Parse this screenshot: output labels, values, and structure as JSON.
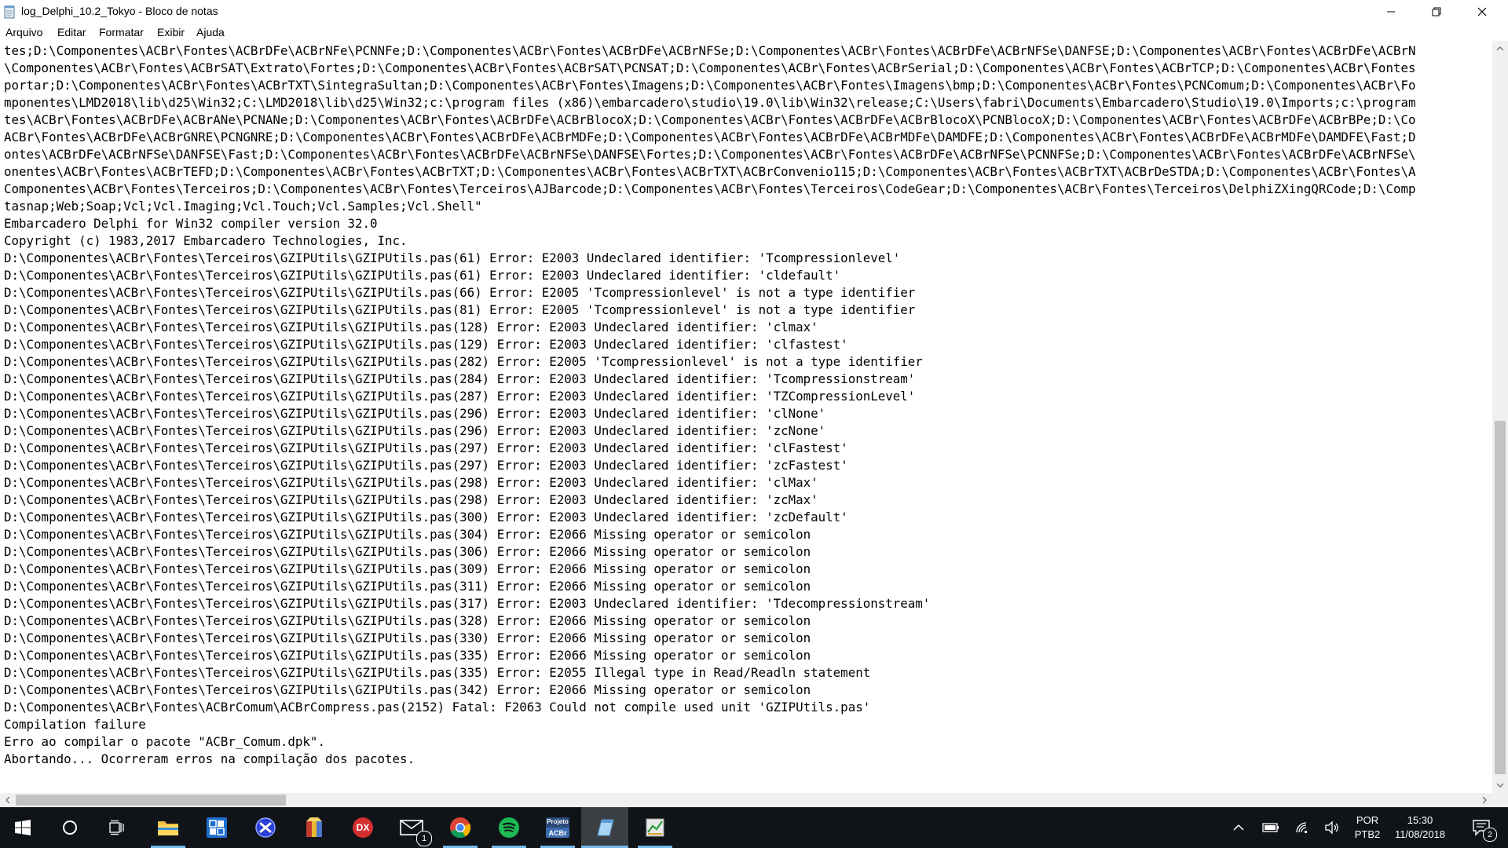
{
  "window": {
    "title": "log_Delphi_10.2_Tokyo - Bloco de notas",
    "icons": [
      "notepad-icon",
      "minimize-icon",
      "maximize-icon",
      "close-icon"
    ]
  },
  "menu": {
    "items": [
      "Arquivo",
      "Editar",
      "Formatar",
      "Exibir",
      "Ajuda"
    ]
  },
  "editor": {
    "lines": [
      "tes;D:\\Componentes\\ACBr\\Fontes\\ACBrDFe\\ACBrNFe\\PCNNFe;D:\\Componentes\\ACBr\\Fontes\\ACBrDFe\\ACBrNFSe;D:\\Componentes\\ACBr\\Fontes\\ACBrDFe\\ACBrNFSe\\DANFSE;D:\\Componentes\\ACBr\\Fontes\\ACBrDFe\\ACBrN",
      "\\Componentes\\ACBr\\Fontes\\ACBrSAT\\Extrato\\Fortes;D:\\Componentes\\ACBr\\Fontes\\ACBrSAT\\PCNSAT;D:\\Componentes\\ACBr\\Fontes\\ACBrSerial;D:\\Componentes\\ACBr\\Fontes\\ACBrTCP;D:\\Componentes\\ACBr\\Fontes",
      "portar;D:\\Componentes\\ACBr\\Fontes\\ACBrTXT\\SintegraSultan;D:\\Componentes\\ACBr\\Fontes\\Imagens;D:\\Componentes\\ACBr\\Fontes\\Imagens\\bmp;D:\\Componentes\\ACBr\\Fontes\\PCNComum;D:\\Componentes\\ACBr\\Fo",
      "mponentes\\LMD2018\\lib\\d25\\Win32;C:\\LMD2018\\lib\\d25\\Win32;c:\\program files (x86)\\embarcadero\\studio\\19.0\\lib\\Win32\\release;C:\\Users\\fabri\\Documents\\Embarcadero\\Studio\\19.0\\Imports;c:\\program",
      "tes\\ACBr\\Fontes\\ACBrDFe\\ACBrANe\\PCNANe;D:\\Componentes\\ACBr\\Fontes\\ACBrDFe\\ACBrBlocoX;D:\\Componentes\\ACBr\\Fontes\\ACBrDFe\\ACBrBlocoX\\PCNBlocoX;D:\\Componentes\\ACBr\\Fontes\\ACBrDFe\\ACBrBPe;D:\\Co",
      "ACBr\\Fontes\\ACBrDFe\\ACBrGNRE\\PCNGNRE;D:\\Componentes\\ACBr\\Fontes\\ACBrDFe\\ACBrMDFe;D:\\Componentes\\ACBr\\Fontes\\ACBrDFe\\ACBrMDFe\\DAMDFE;D:\\Componentes\\ACBr\\Fontes\\ACBrDFe\\ACBrMDFe\\DAMDFE\\Fast;D",
      "ontes\\ACBrDFe\\ACBrNFSe\\DANFSE\\Fast;D:\\Componentes\\ACBr\\Fontes\\ACBrDFe\\ACBrNFSe\\DANFSE\\Fortes;D:\\Componentes\\ACBr\\Fontes\\ACBrDFe\\ACBrNFSe\\PCNNFSe;D:\\Componentes\\ACBr\\Fontes\\ACBrDFe\\ACBrNFSe\\",
      "onentes\\ACBr\\Fontes\\ACBrTEFD;D:\\Componentes\\ACBr\\Fontes\\ACBrTXT;D:\\Componentes\\ACBr\\Fontes\\ACBrTXT\\ACBrConvenio115;D:\\Componentes\\ACBr\\Fontes\\ACBrTXT\\ACBrDeSTDA;D:\\Componentes\\ACBr\\Fontes\\A",
      "Componentes\\ACBr\\Fontes\\Terceiros;D:\\Componentes\\ACBr\\Fontes\\Terceiros\\AJBarcode;D:\\Componentes\\ACBr\\Fontes\\Terceiros\\CodeGear;D:\\Componentes\\ACBr\\Fontes\\Terceiros\\DelphiZXingQRCode;D:\\Comp",
      "tasnap;Web;Soap;Vcl;Vcl.Imaging;Vcl.Touch;Vcl.Samples;Vcl.Shell\"",
      "Embarcadero Delphi for Win32 compiler version 32.0",
      "Copyright (c) 1983,2017 Embarcadero Technologies, Inc.",
      "D:\\Componentes\\ACBr\\Fontes\\Terceiros\\GZIPUtils\\GZIPUtils.pas(61) Error: E2003 Undeclared identifier: 'Tcompressionlevel'",
      "D:\\Componentes\\ACBr\\Fontes\\Terceiros\\GZIPUtils\\GZIPUtils.pas(61) Error: E2003 Undeclared identifier: 'cldefault'",
      "D:\\Componentes\\ACBr\\Fontes\\Terceiros\\GZIPUtils\\GZIPUtils.pas(66) Error: E2005 'Tcompressionlevel' is not a type identifier",
      "D:\\Componentes\\ACBr\\Fontes\\Terceiros\\GZIPUtils\\GZIPUtils.pas(81) Error: E2005 'Tcompressionlevel' is not a type identifier",
      "D:\\Componentes\\ACBr\\Fontes\\Terceiros\\GZIPUtils\\GZIPUtils.pas(128) Error: E2003 Undeclared identifier: 'clmax'",
      "D:\\Componentes\\ACBr\\Fontes\\Terceiros\\GZIPUtils\\GZIPUtils.pas(129) Error: E2003 Undeclared identifier: 'clfastest'",
      "D:\\Componentes\\ACBr\\Fontes\\Terceiros\\GZIPUtils\\GZIPUtils.pas(282) Error: E2005 'Tcompressionlevel' is not a type identifier",
      "D:\\Componentes\\ACBr\\Fontes\\Terceiros\\GZIPUtils\\GZIPUtils.pas(284) Error: E2003 Undeclared identifier: 'Tcompressionstream'",
      "D:\\Componentes\\ACBr\\Fontes\\Terceiros\\GZIPUtils\\GZIPUtils.pas(287) Error: E2003 Undeclared identifier: 'TZCompressionLevel'",
      "D:\\Componentes\\ACBr\\Fontes\\Terceiros\\GZIPUtils\\GZIPUtils.pas(296) Error: E2003 Undeclared identifier: 'clNone'",
      "D:\\Componentes\\ACBr\\Fontes\\Terceiros\\GZIPUtils\\GZIPUtils.pas(296) Error: E2003 Undeclared identifier: 'zcNone'",
      "D:\\Componentes\\ACBr\\Fontes\\Terceiros\\GZIPUtils\\GZIPUtils.pas(297) Error: E2003 Undeclared identifier: 'clFastest'",
      "D:\\Componentes\\ACBr\\Fontes\\Terceiros\\GZIPUtils\\GZIPUtils.pas(297) Error: E2003 Undeclared identifier: 'zcFastest'",
      "D:\\Componentes\\ACBr\\Fontes\\Terceiros\\GZIPUtils\\GZIPUtils.pas(298) Error: E2003 Undeclared identifier: 'clMax'",
      "D:\\Componentes\\ACBr\\Fontes\\Terceiros\\GZIPUtils\\GZIPUtils.pas(298) Error: E2003 Undeclared identifier: 'zcMax'",
      "D:\\Componentes\\ACBr\\Fontes\\Terceiros\\GZIPUtils\\GZIPUtils.pas(300) Error: E2003 Undeclared identifier: 'zcDefault'",
      "D:\\Componentes\\ACBr\\Fontes\\Terceiros\\GZIPUtils\\GZIPUtils.pas(304) Error: E2066 Missing operator or semicolon",
      "D:\\Componentes\\ACBr\\Fontes\\Terceiros\\GZIPUtils\\GZIPUtils.pas(306) Error: E2066 Missing operator or semicolon",
      "D:\\Componentes\\ACBr\\Fontes\\Terceiros\\GZIPUtils\\GZIPUtils.pas(309) Error: E2066 Missing operator or semicolon",
      "D:\\Componentes\\ACBr\\Fontes\\Terceiros\\GZIPUtils\\GZIPUtils.pas(311) Error: E2066 Missing operator or semicolon",
      "D:\\Componentes\\ACBr\\Fontes\\Terceiros\\GZIPUtils\\GZIPUtils.pas(317) Error: E2003 Undeclared identifier: 'Tdecompressionstream'",
      "D:\\Componentes\\ACBr\\Fontes\\Terceiros\\GZIPUtils\\GZIPUtils.pas(328) Error: E2066 Missing operator or semicolon",
      "D:\\Componentes\\ACBr\\Fontes\\Terceiros\\GZIPUtils\\GZIPUtils.pas(330) Error: E2066 Missing operator or semicolon",
      "D:\\Componentes\\ACBr\\Fontes\\Terceiros\\GZIPUtils\\GZIPUtils.pas(335) Error: E2066 Missing operator or semicolon",
      "D:\\Componentes\\ACBr\\Fontes\\Terceiros\\GZIPUtils\\GZIPUtils.pas(335) Error: E2055 Illegal type in Read/Readln statement",
      "D:\\Componentes\\ACBr\\Fontes\\Terceiros\\GZIPUtils\\GZIPUtils.pas(342) Error: E2066 Missing operator or semicolon",
      "D:\\Componentes\\ACBr\\Fontes\\ACBrComum\\ACBrCompress.pas(2152) Fatal: F2063 Could not compile used unit 'GZIPUtils.pas'",
      "Compilation failure",
      "Erro ao compilar o pacote \"ACBr_Comum.dpk\".",
      "Abortando... Ocorreram erros na compilação dos pacotes."
    ]
  },
  "taskbar": {
    "apps": [
      {
        "icon": "start-windows-icon",
        "active": false
      },
      {
        "icon": "cortana-search-icon",
        "active": false
      },
      {
        "icon": "task-view-icon",
        "active": false
      },
      {
        "icon": "file-explorer-icon",
        "active": false
      },
      {
        "icon": "app-blue-tiles-icon",
        "active": false
      },
      {
        "icon": "app-blue-circle-icon",
        "active": false
      },
      {
        "icon": "app-package-icon",
        "active": false
      },
      {
        "icon": "app-dx-icon",
        "active": false
      },
      {
        "icon": "mail-icon",
        "active": false
      },
      {
        "icon": "chrome-icon",
        "active": false
      },
      {
        "icon": "spotify-icon",
        "active": false
      },
      {
        "icon": "projeto-acbr-icon",
        "active": false
      },
      {
        "icon": "notepad-icon",
        "active": true
      },
      {
        "icon": "app-chart-icon",
        "active": false
      }
    ],
    "mail_badge": "1",
    "dx_label": "DX",
    "projeto_label": "Projeto",
    "acbr_label": "ACBr",
    "tray": {
      "icons": [
        "chevron-up-icon",
        "battery-icon",
        "wifi-icon",
        "volume-icon",
        "notification-icon"
      ],
      "language_top": "POR",
      "language_bottom": "PTB2",
      "time": "15:30",
      "date": "11/08/2018",
      "notification_count": "2"
    },
    "colors": {
      "background": "#101418",
      "active_indicator": "#76b9ed",
      "spotify": "#1db954",
      "dx": "#d32f2f"
    }
  }
}
